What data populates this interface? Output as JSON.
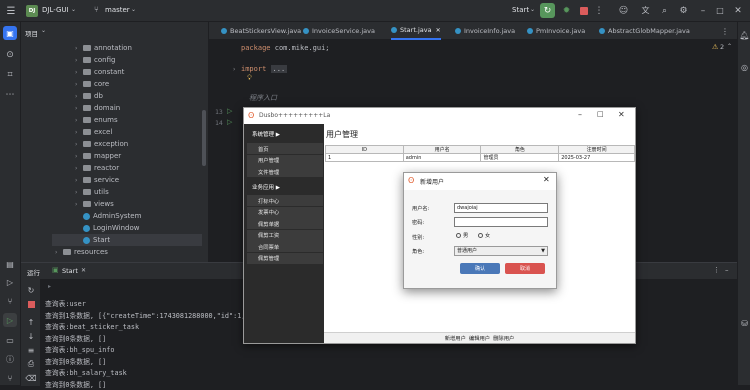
{
  "ide": {
    "project_initials": "DJ",
    "project_name": "DJL-GUI",
    "branch": "master",
    "run_config": "Start"
  },
  "project_tree": {
    "panel_title": "项目",
    "items": [
      {
        "label": "annotation",
        "type": "folder"
      },
      {
        "label": "config",
        "type": "folder"
      },
      {
        "label": "constant",
        "type": "folder"
      },
      {
        "label": "core",
        "type": "folder"
      },
      {
        "label": "db",
        "type": "folder"
      },
      {
        "label": "domain",
        "type": "folder"
      },
      {
        "label": "enums",
        "type": "folder"
      },
      {
        "label": "excel",
        "type": "folder"
      },
      {
        "label": "exception",
        "type": "folder"
      },
      {
        "label": "mapper",
        "type": "folder"
      },
      {
        "label": "reactor",
        "type": "folder"
      },
      {
        "label": "service",
        "type": "folder"
      },
      {
        "label": "utils",
        "type": "folder"
      },
      {
        "label": "views",
        "type": "folder"
      },
      {
        "label": "AdminSystem",
        "type": "class"
      },
      {
        "label": "LoginWindow",
        "type": "class"
      },
      {
        "label": "Start",
        "type": "class"
      },
      {
        "label": "resources",
        "type": "folder"
      }
    ]
  },
  "editor": {
    "tabs": [
      "BeatStickersView.java",
      "InvoiceService.java",
      "Start.java",
      "InvoiceInfo.java",
      "PmInvoice.java",
      "AbstractGlobMapper.java"
    ],
    "active_tab": "Start.java",
    "warning_count": "2",
    "line_numbers": [
      "13",
      "14"
    ],
    "code_package_kw": "package",
    "code_package_name": "com.mike.gui;",
    "code_import_kw": "import",
    "code_import_folded": "...",
    "code_comment": "程序入口"
  },
  "run_panel": {
    "tab_label": "运行",
    "config_tab": "Start",
    "console_lines": [
      "查询表:user",
      "查询到1条数据, [{\"createTime\":1743081288000,\"id\":1,\"",
      "查询表:beat_sticker_task",
      "查询到0条数据, []",
      "查询表:bh_spu_info",
      "查询到0条数据, []",
      "查询表:bh_salary_task",
      "查询到0条数据, []"
    ]
  },
  "app_window": {
    "title": "Dusbo+++++++++La",
    "sidebar": {
      "group1_label": "系统管理 ▶",
      "group1_items": [
        "首页",
        "用户管理",
        "文件管理"
      ],
      "group2_label": "业务应用 ▶",
      "group2_items": [
        "打标中心",
        "发票中心",
        "佩剪单据",
        "佩剪工资",
        "合同票单",
        "佩剪管理"
      ]
    },
    "page_title": "用户管理",
    "table": {
      "headers": [
        "ID",
        "用户名",
        "角色",
        "注册时间"
      ],
      "rows": [
        [
          "1",
          "admin",
          "管理员",
          "2025-03-27"
        ]
      ]
    },
    "bottom_actions": [
      "新增用户",
      "编辑用户",
      "删除用户"
    ]
  },
  "dialog": {
    "title": "新增用户",
    "username_label": "用户名:",
    "username_value": "dwajoiaj",
    "password_label": "密码:",
    "gender_label": "性别:",
    "gender_male": "男",
    "gender_female": "女",
    "role_label": "角色:",
    "role_value": "普通用户",
    "confirm_label": "确认",
    "cancel_label": "取消"
  },
  "colors": {
    "run_button": "#57965c",
    "confirm_button": "#4a78b8",
    "cancel_button": "#d9534f"
  }
}
